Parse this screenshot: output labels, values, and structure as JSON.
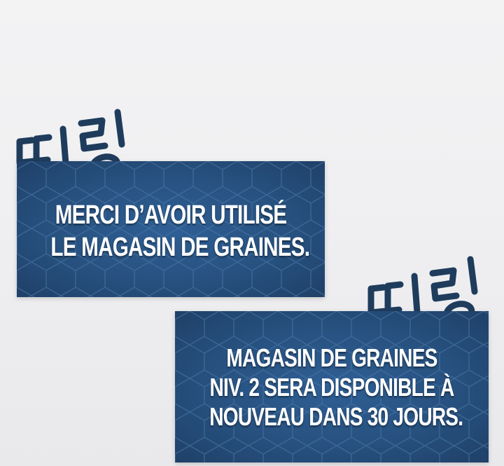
{
  "sfx": [
    {
      "text": "띠링"
    },
    {
      "text": "띠링"
    }
  ],
  "panels": [
    {
      "lines": [
        "MERCI D’AVOIR UTILISÉ",
        "LE MAGASIN DE GRAINES."
      ]
    },
    {
      "lines": [
        "MAGASIN DE GRAINES",
        "NIV. 2 SERA DISPONIBLE À",
        "NOUVEAU DANS 30 JOURS."
      ]
    }
  ],
  "colors": {
    "panel": "#27517f",
    "hexline": "#4b78a8",
    "sfx": "#1f3c5c",
    "text": "#ffffff"
  }
}
